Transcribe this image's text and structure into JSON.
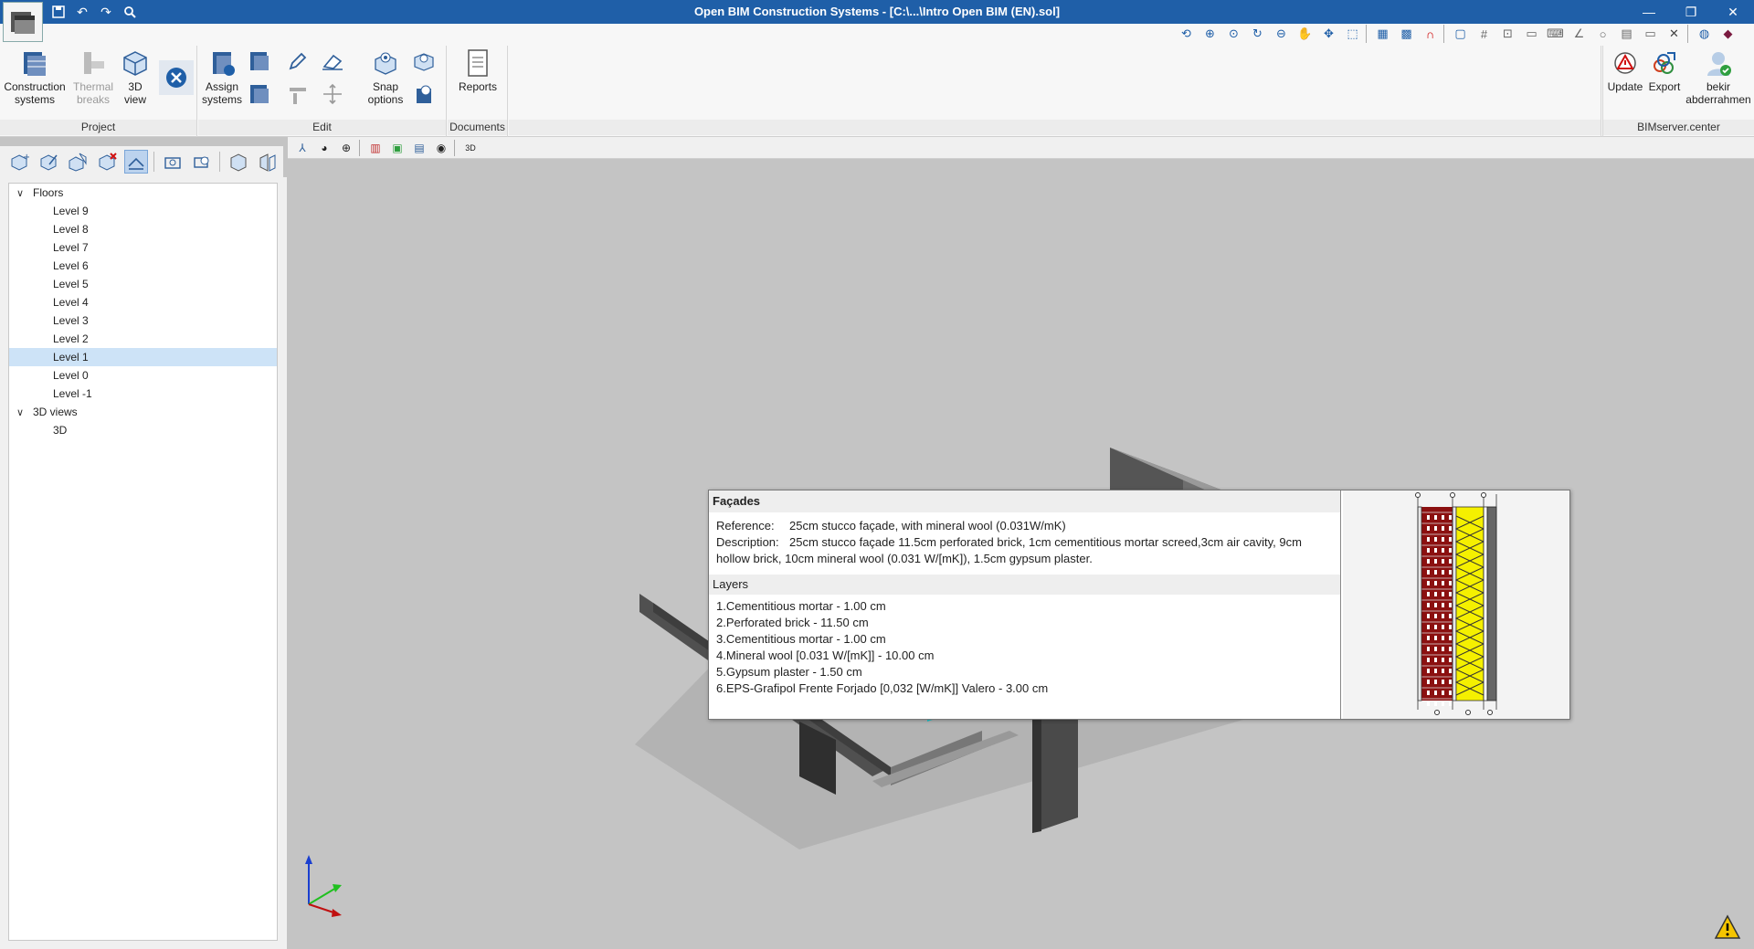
{
  "window": {
    "title": "Open BIM Construction Systems - [C:\\...\\Intro Open BIM (EN).sol]",
    "controls": [
      "minimize",
      "restore",
      "close"
    ]
  },
  "quick_access": [
    "save-icon",
    "undo-icon",
    "redo-icon",
    "search-icon"
  ],
  "ribbon": {
    "project": {
      "label": "Project",
      "construction_systems": "Construction\nsystems",
      "thermal_breaks": "Thermal\nbreaks",
      "view_3d": "3D\nview"
    },
    "edit": {
      "label": "Edit",
      "assign_systems": "Assign\nsystems",
      "snap_options": "Snap\noptions"
    },
    "documents": {
      "label": "Documents",
      "reports": "Reports"
    },
    "bimserver": {
      "label": "BIMserver.center",
      "update": "Update",
      "export": "Export",
      "user": "bekir\nabderrahmen"
    }
  },
  "tree": {
    "floors_label": "Floors",
    "levels": [
      "Level 9",
      "Level 8",
      "Level 7",
      "Level 6",
      "Level 5",
      "Level 4",
      "Level 3",
      "Level 2",
      "Level 1",
      "Level 0",
      "Level -1"
    ],
    "selected_level": "Level 1",
    "views_label": "3D views",
    "views": [
      "3D"
    ]
  },
  "popup": {
    "title": "Façades",
    "reference_label": "Reference:",
    "reference": "25cm stucco façade, with mineral wool (0.031W/mK)",
    "description_label": "Description:",
    "description": "25cm stucco façade 11.5cm perforated brick, 1cm cementitious mortar screed,3cm air cavity, 9cm hollow brick, 10cm mineral wool (0.031 W/[mK]), 1.5cm gypsum plaster.",
    "layers_label": "Layers",
    "layers": [
      "1.Cementitious mortar - 1.00 cm",
      "2.Perforated brick - 11.50 cm",
      "3.Cementitious mortar - 1.00 cm",
      "4.Mineral wool  [0.031 W/[mK]] - 10.00 cm",
      "5.Gypsum plaster - 1.50 cm",
      "6.EPS-Grafipol Frente Forjado [0,032 [W/mK]] Valero - 3.00 cm"
    ]
  },
  "colors": {
    "titlebar": "#1f5fa8",
    "accent_cyan": "#1ec8cf",
    "brick": "#8b1010",
    "wool": "#f5f000"
  }
}
